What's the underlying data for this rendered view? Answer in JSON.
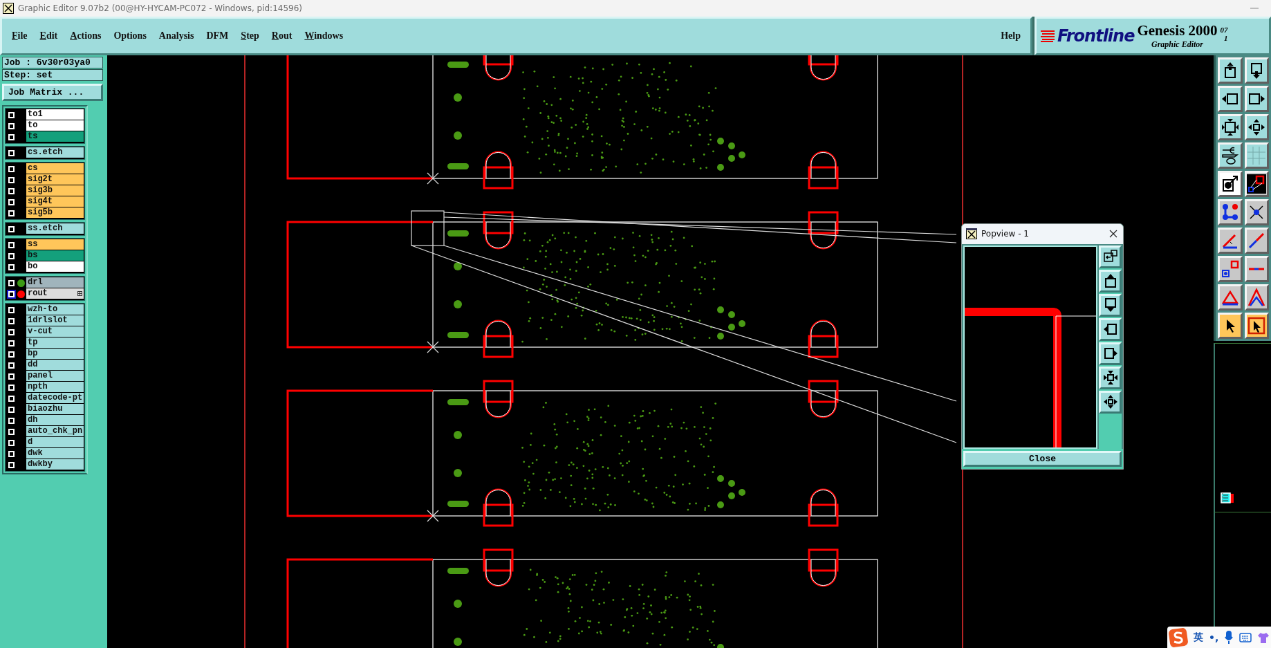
{
  "window": {
    "title": "Graphic Editor 9.07b2 (00@HY-HYCAM-PC072 - Windows, pid:14596)"
  },
  "menu": [
    {
      "label": "File",
      "underlined": true
    },
    {
      "label": "Edit",
      "underlined": true
    },
    {
      "label": "Actions",
      "underlined": true
    },
    {
      "label": "Options",
      "underlined": false
    },
    {
      "label": "Analysis",
      "underlined": false
    },
    {
      "label": "DFM",
      "underlined": false
    },
    {
      "label": "Step",
      "underlined": true
    },
    {
      "label": "Rout",
      "underlined": true
    },
    {
      "label": "Windows",
      "underlined": true
    }
  ],
  "help": "Help",
  "brand": {
    "logo": "Frontline",
    "product": "Genesis 2000",
    "subtitle": "Graphic Editor",
    "version": [
      "07",
      "1"
    ]
  },
  "job": {
    "job": "Job : 6v30r03ya0",
    "step": "Step: set",
    "matrix_button": "Job Matrix ..."
  },
  "layer_groups": [
    {
      "layers": [
        {
          "name": "to1",
          "color": "#ffffff",
          "active": false,
          "marked": false
        },
        {
          "name": "to",
          "color": "#ffffff",
          "active": false,
          "marked": false
        },
        {
          "name": "ts",
          "color": "#14a07c",
          "active": false,
          "marked": false
        }
      ]
    },
    {
      "layers": [
        {
          "name": "cs.etch",
          "color": "#a0dcdc",
          "active": false,
          "marked": false
        }
      ]
    },
    {
      "layers": [
        {
          "name": "cs",
          "color": "#ffc65a",
          "active": false,
          "marked": false
        },
        {
          "name": "sig2t",
          "color": "#ffc65a",
          "active": false,
          "marked": false
        },
        {
          "name": "sig3b",
          "color": "#ffc65a",
          "active": false,
          "marked": false
        },
        {
          "name": "sig4t",
          "color": "#ffc65a",
          "active": false,
          "marked": false
        },
        {
          "name": "sig5b",
          "color": "#ffc65a",
          "active": false,
          "marked": false
        }
      ]
    },
    {
      "layers": [
        {
          "name": "ss.etch",
          "color": "#a0dcdc",
          "active": false,
          "marked": false
        }
      ]
    },
    {
      "layers": [
        {
          "name": "ss",
          "color": "#ffc65a",
          "active": false,
          "marked": false
        },
        {
          "name": "bs",
          "color": "#14a07c",
          "active": false,
          "marked": false
        },
        {
          "name": "bo",
          "color": "#ffffff",
          "active": false,
          "marked": false
        }
      ]
    },
    {
      "layers": [
        {
          "name": "drl",
          "color": "#a0b4bc",
          "dot": {
            "color": "#3c9a14"
          },
          "active": false,
          "marked": false
        },
        {
          "name": "rout",
          "color": "#dcdcdc",
          "dot": {
            "color": "#ff0000"
          },
          "active": true,
          "marked": true
        }
      ]
    },
    {
      "layers": [
        {
          "name": "wzh-to",
          "color": "#a0dcdc",
          "active": false,
          "marked": false
        },
        {
          "name": "1drlslot",
          "color": "#a0dcdc",
          "active": false,
          "marked": false
        },
        {
          "name": "v-cut",
          "color": "#a0dcdc",
          "active": false,
          "marked": false
        },
        {
          "name": "tp",
          "color": "#a0dcdc",
          "active": false,
          "marked": false
        },
        {
          "name": "bp",
          "color": "#a0dcdc",
          "active": false,
          "marked": false
        },
        {
          "name": "dd",
          "color": "#a0dcdc",
          "active": false,
          "marked": false
        },
        {
          "name": "panel",
          "color": "#a0dcdc",
          "active": false,
          "marked": false
        },
        {
          "name": "npth",
          "color": "#a0dcdc",
          "active": false,
          "marked": false
        },
        {
          "name": "datecode-pt",
          "color": "#a0dcdc",
          "active": false,
          "marked": false
        },
        {
          "name": "biaozhu",
          "color": "#a0dcdc",
          "active": false,
          "marked": false
        },
        {
          "name": "dh",
          "color": "#a0dcdc",
          "active": false,
          "marked": false
        },
        {
          "name": "auto_chk_pn",
          "color": "#a0dcdc",
          "active": false,
          "marked": false
        },
        {
          "name": "d",
          "color": "#a0dcdc",
          "active": false,
          "marked": false
        },
        {
          "name": "dwk",
          "color": "#a0dcdc",
          "active": false,
          "marked": false
        },
        {
          "name": "dwkby",
          "color": "#a0dcdc",
          "active": false,
          "marked": false
        }
      ]
    }
  ],
  "toolbar": [
    {
      "kind": "view",
      "selected": false
    },
    {
      "kind": "view",
      "selected": false
    },
    {
      "kind": "view",
      "selected": false
    },
    {
      "kind": "view",
      "selected": false
    },
    {
      "kind": "view",
      "selected": false
    },
    {
      "kind": "view",
      "selected": false
    },
    {
      "kind": "view",
      "selected": false
    },
    {
      "kind": "view",
      "selected": false
    },
    {
      "kind": "edit",
      "selected": true
    },
    {
      "kind": "edit",
      "selected": false
    },
    {
      "kind": "edit",
      "selected": false
    },
    {
      "kind": "edit",
      "selected": false
    },
    {
      "kind": "edit",
      "selected": false
    },
    {
      "kind": "edit",
      "selected": false
    },
    {
      "kind": "edit",
      "selected": false
    },
    {
      "kind": "edit",
      "selected": false
    },
    {
      "kind": "edit",
      "selected": false
    },
    {
      "kind": "edit",
      "selected": false
    },
    {
      "kind": "select",
      "selected": false
    },
    {
      "kind": "select",
      "selected": false
    }
  ],
  "popview": {
    "title": "Popview - 1",
    "close": "Close"
  },
  "ime": {
    "mode": "英",
    "punctuation": "•,"
  }
}
